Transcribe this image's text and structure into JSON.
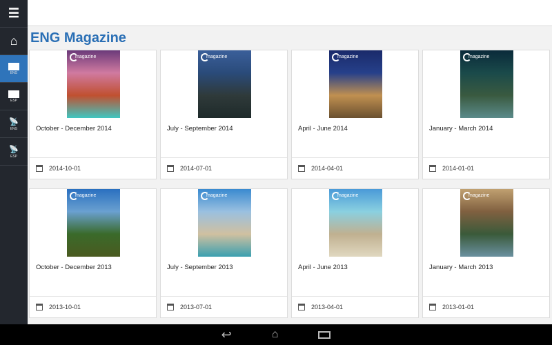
{
  "sidebar": {
    "items": [
      {
        "name": "menu",
        "label": ""
      },
      {
        "name": "home",
        "label": ""
      },
      {
        "name": "eng-magazine",
        "label": "ENG",
        "active": true
      },
      {
        "name": "esp-magazine",
        "label": "ESP"
      },
      {
        "name": "eng-radio",
        "label": "ENG"
      },
      {
        "name": "esp-radio",
        "label": "ESP"
      }
    ]
  },
  "page": {
    "title": "ENG Magazine"
  },
  "cover_brand": "magazine",
  "issues": [
    {
      "title": "October - December 2014",
      "date": "2014-10-01",
      "colors": [
        "#6b3a7a",
        "#d07aa0",
        "#c05030",
        "#3fc6c0"
      ]
    },
    {
      "title": "July - September 2014",
      "date": "2014-07-01",
      "colors": [
        "#3b5f9a",
        "#2a4b7a",
        "#2f3a3a",
        "#1e2a2a"
      ]
    },
    {
      "title": "April - June 2014",
      "date": "2014-04-01",
      "colors": [
        "#1a2a6a",
        "#26408a",
        "#c09050",
        "#6a5030"
      ]
    },
    {
      "title": "January - March 2014",
      "date": "2014-01-01",
      "colors": [
        "#0a2a3a",
        "#1a4a4a",
        "#3a5a40",
        "#5a8a8a"
      ]
    },
    {
      "title": "October - December 2013",
      "date": "2013-10-01",
      "colors": [
        "#2a70c0",
        "#6aa0d0",
        "#3a6a2a",
        "#4a5a20"
      ]
    },
    {
      "title": "July - September 2013",
      "date": "2013-07-01",
      "colors": [
        "#3a8ad0",
        "#9ac0e0",
        "#d0c0a0",
        "#3aa0b0"
      ]
    },
    {
      "title": "April - June 2013",
      "date": "2013-04-01",
      "colors": [
        "#4a9ad8",
        "#8ad0e0",
        "#c0b090",
        "#e0d8c0"
      ]
    },
    {
      "title": "January - March 2013",
      "date": "2013-01-01",
      "colors": [
        "#c0a070",
        "#806040",
        "#3a5a3a",
        "#6a90a0"
      ]
    }
  ]
}
